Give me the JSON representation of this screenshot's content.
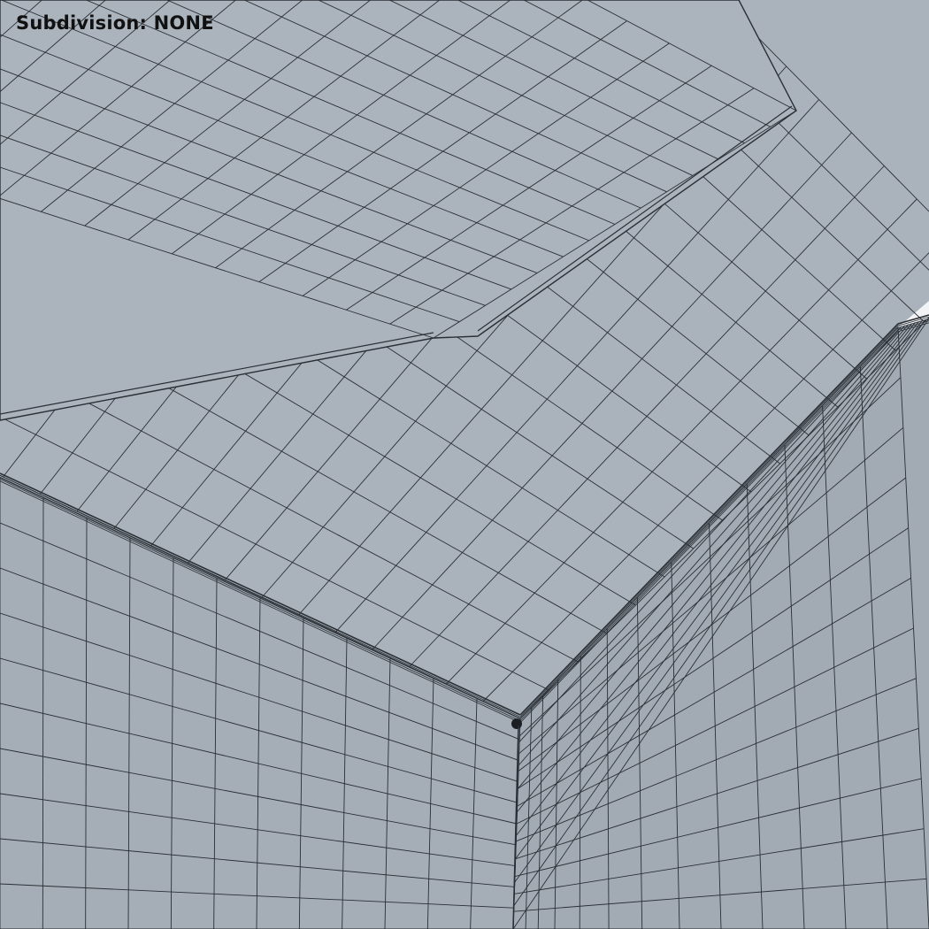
{
  "overlay": {
    "subdivision_text": "Subdivision: NONE"
  },
  "scene": {
    "subject": "cardboard box corner",
    "view": "wireframe on shaded",
    "background_color": "#f2f3f4",
    "surface_color": "#a9b2bb",
    "top_face_color": "#aab3bc",
    "side_face_color": "#a5aeb7",
    "right_face_color": "#a2abb4",
    "flap_color": "#abb4bd",
    "wire_color": "#2a2f35"
  }
}
